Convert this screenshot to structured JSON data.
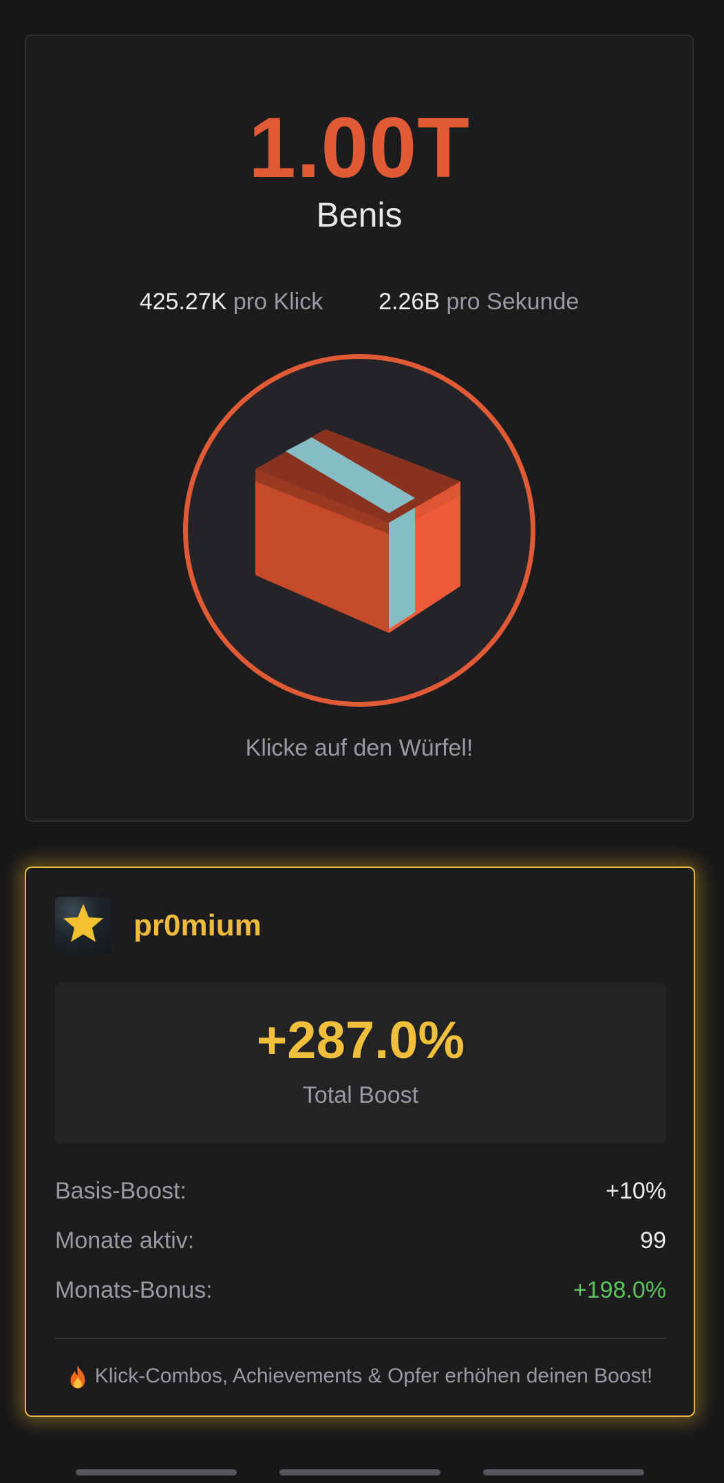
{
  "main": {
    "score": "1.00T",
    "unit": "Benis",
    "per_click_value": "425.27K",
    "per_click_label": "pro Klick",
    "per_second_value": "2.26B",
    "per_second_label": "pro Sekunde",
    "cube_icon": "cube-icon",
    "hint": "Klicke auf den Würfel!"
  },
  "premium": {
    "icon": "star-icon",
    "name": "pr0mium",
    "total_boost_value": "+287.0%",
    "total_boost_label": "Total Boost",
    "stats": [
      {
        "label": "Basis-Boost:",
        "value": "+10%"
      },
      {
        "label": "Monate aktiv:",
        "value": "99"
      },
      {
        "label": "Monats-Bonus:",
        "value": "+198.0%"
      }
    ],
    "footer_icon": "fire-icon",
    "footer_text": "Klick-Combos, Achievements & Opfer erhöhen deinen Boost!"
  },
  "colors": {
    "accent_orange": "#e05a36",
    "premium_gold": "#efbb3e",
    "bonus_green": "#5cc35c"
  }
}
